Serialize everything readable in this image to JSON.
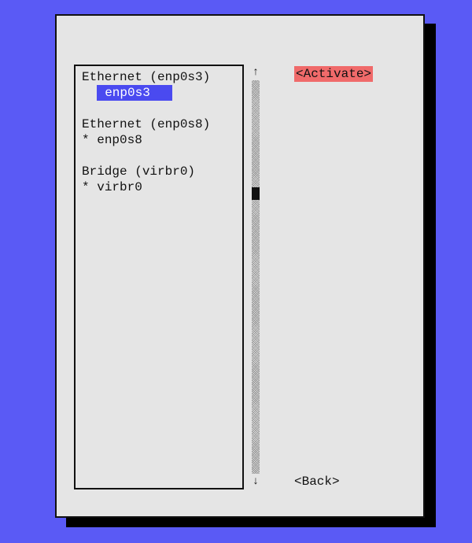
{
  "connections": [
    {
      "header": "Ethernet (enp0s3)",
      "item_label": "enp0s3",
      "active_marker": " ",
      "selected": true
    },
    {
      "header": "Ethernet (enp0s8)",
      "item_label": "enp0s8",
      "active_marker": "*",
      "selected": false
    },
    {
      "header": "Bridge (virbr0)",
      "item_label": "virbr0",
      "active_marker": "*",
      "selected": false
    }
  ],
  "buttons": {
    "activate": "<Activate>",
    "back": "<Back>"
  },
  "scrollbar": {
    "arrow_up": "↑",
    "arrow_down": "↓",
    "thumb_position_pct": 28
  }
}
